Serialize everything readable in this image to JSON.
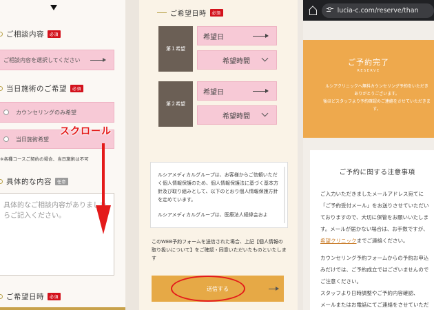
{
  "panel1": {
    "consult_heading": "ご相談内容",
    "required": "必須",
    "consult_select": "ご相談内容を選択してください",
    "sameday_heading": "当日施術のご希望",
    "option_counseling": "カウンセリングのみ希望",
    "option_sameday": "当日施術希望",
    "note": "※各種コースご契約の場合、当日施術は不可",
    "detail_heading": "具体的な内容",
    "optional": "任意",
    "detail_placeholder": "具体的なご相談内容がありましたらご記入ください。",
    "date_heading": "ご希望日時",
    "scroll_label": "スクロール"
  },
  "panel2": {
    "date_heading": "ご希望日時",
    "required": "必須",
    "choice1": "第１希望",
    "choice2": "第２希望",
    "date_label": "希望日",
    "time_label": "希望時間",
    "privacy_p1": "ルシアメディカルグループは、お客様からご信頼いただく個人情報保護のため、個人情報保護法に基づく基本方針及び取り組みとして、以下のとおり個人情報保護方針を定めています。",
    "privacy_p2": "ルシアメディカルグループは、医療法人経緯会およ",
    "agree_text": "このWEB予約フォームを送信された場合、上記【個人情報の取り扱いについて】をご確認・同意いただいたものといたします",
    "submit_label": "送信する"
  },
  "panel3": {
    "url": "lucia-c.com/reserve/than",
    "done_title": "ご予約完了",
    "done_sub": "RESERVE",
    "done_text": "ルシアクリニックへ無料カウンセリング予約をいただき\nありがとうございます。\n後ほどスタッフより予約確認のご連絡をさせていただきます。",
    "notice_heading": "ご予約に関する注意事項",
    "notice_p1": "ご入力いただきましたメールアドレス宛てに\n「ご予約受付メール」をお送りさせていただい\nておりますので、大切に保管をお願いいたしま\nす。メールが届かない場合は、お手数ですが、",
    "notice_link": "希望クリニック",
    "notice_p1_end": "までご連絡ください。",
    "notice_p2": "カウンセリング予約フォームからの予約お申込\nみだけでは、ご予約成立ではございませんので\nご注意ください。\nスタッフより日時調整やご予約内容確認、\nメールまたはお電話にてご連絡をさせていただ"
  }
}
